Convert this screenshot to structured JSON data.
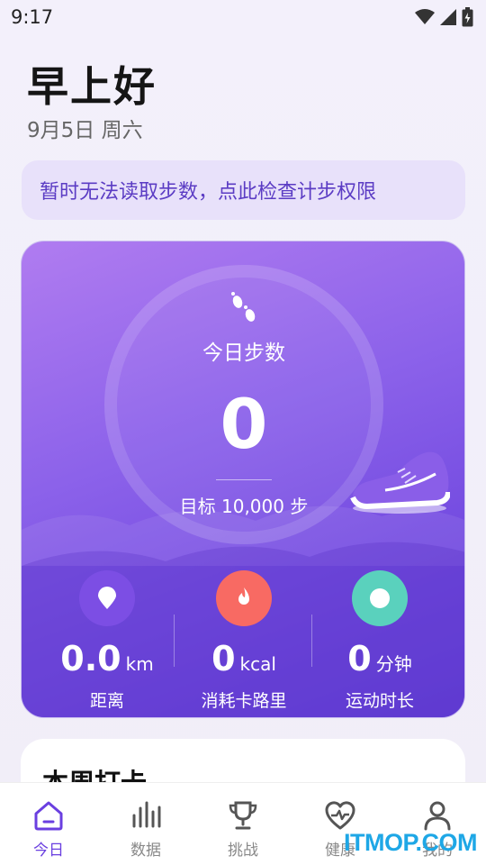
{
  "status_bar": {
    "time": "9:17"
  },
  "header": {
    "greeting": "早上好",
    "date": "9月5日 周六"
  },
  "notice": {
    "text": "暂时无法读取步数，点此检查计步权限"
  },
  "steps_card": {
    "label": "今日步数",
    "value": "0",
    "goal": "目标 10,000 步"
  },
  "metrics": [
    {
      "value": "0.0",
      "unit": "km",
      "label": "距离",
      "color": "#7c4ee4"
    },
    {
      "value": "0",
      "unit": "kcal",
      "label": "消耗卡路里",
      "color": "#f86a63"
    },
    {
      "value": "0",
      "unit": "分钟",
      "label": "运动时长",
      "color": "#5ad1bd"
    }
  ],
  "weekly": {
    "title": "本周打卡"
  },
  "nav": {
    "items": [
      {
        "label": "今日",
        "icon": "home-icon",
        "active": true
      },
      {
        "label": "数据",
        "icon": "bar-chart-icon",
        "active": false
      },
      {
        "label": "挑战",
        "icon": "trophy-icon",
        "active": false
      },
      {
        "label": "健康",
        "icon": "heart-pulse-icon",
        "active": false
      },
      {
        "label": "我的",
        "icon": "person-icon",
        "active": false
      }
    ]
  },
  "watermark": {
    "text": "ITMOP.COM"
  },
  "colors": {
    "accent": "#6a3fe0",
    "notice_text": "#5b3cc4"
  }
}
